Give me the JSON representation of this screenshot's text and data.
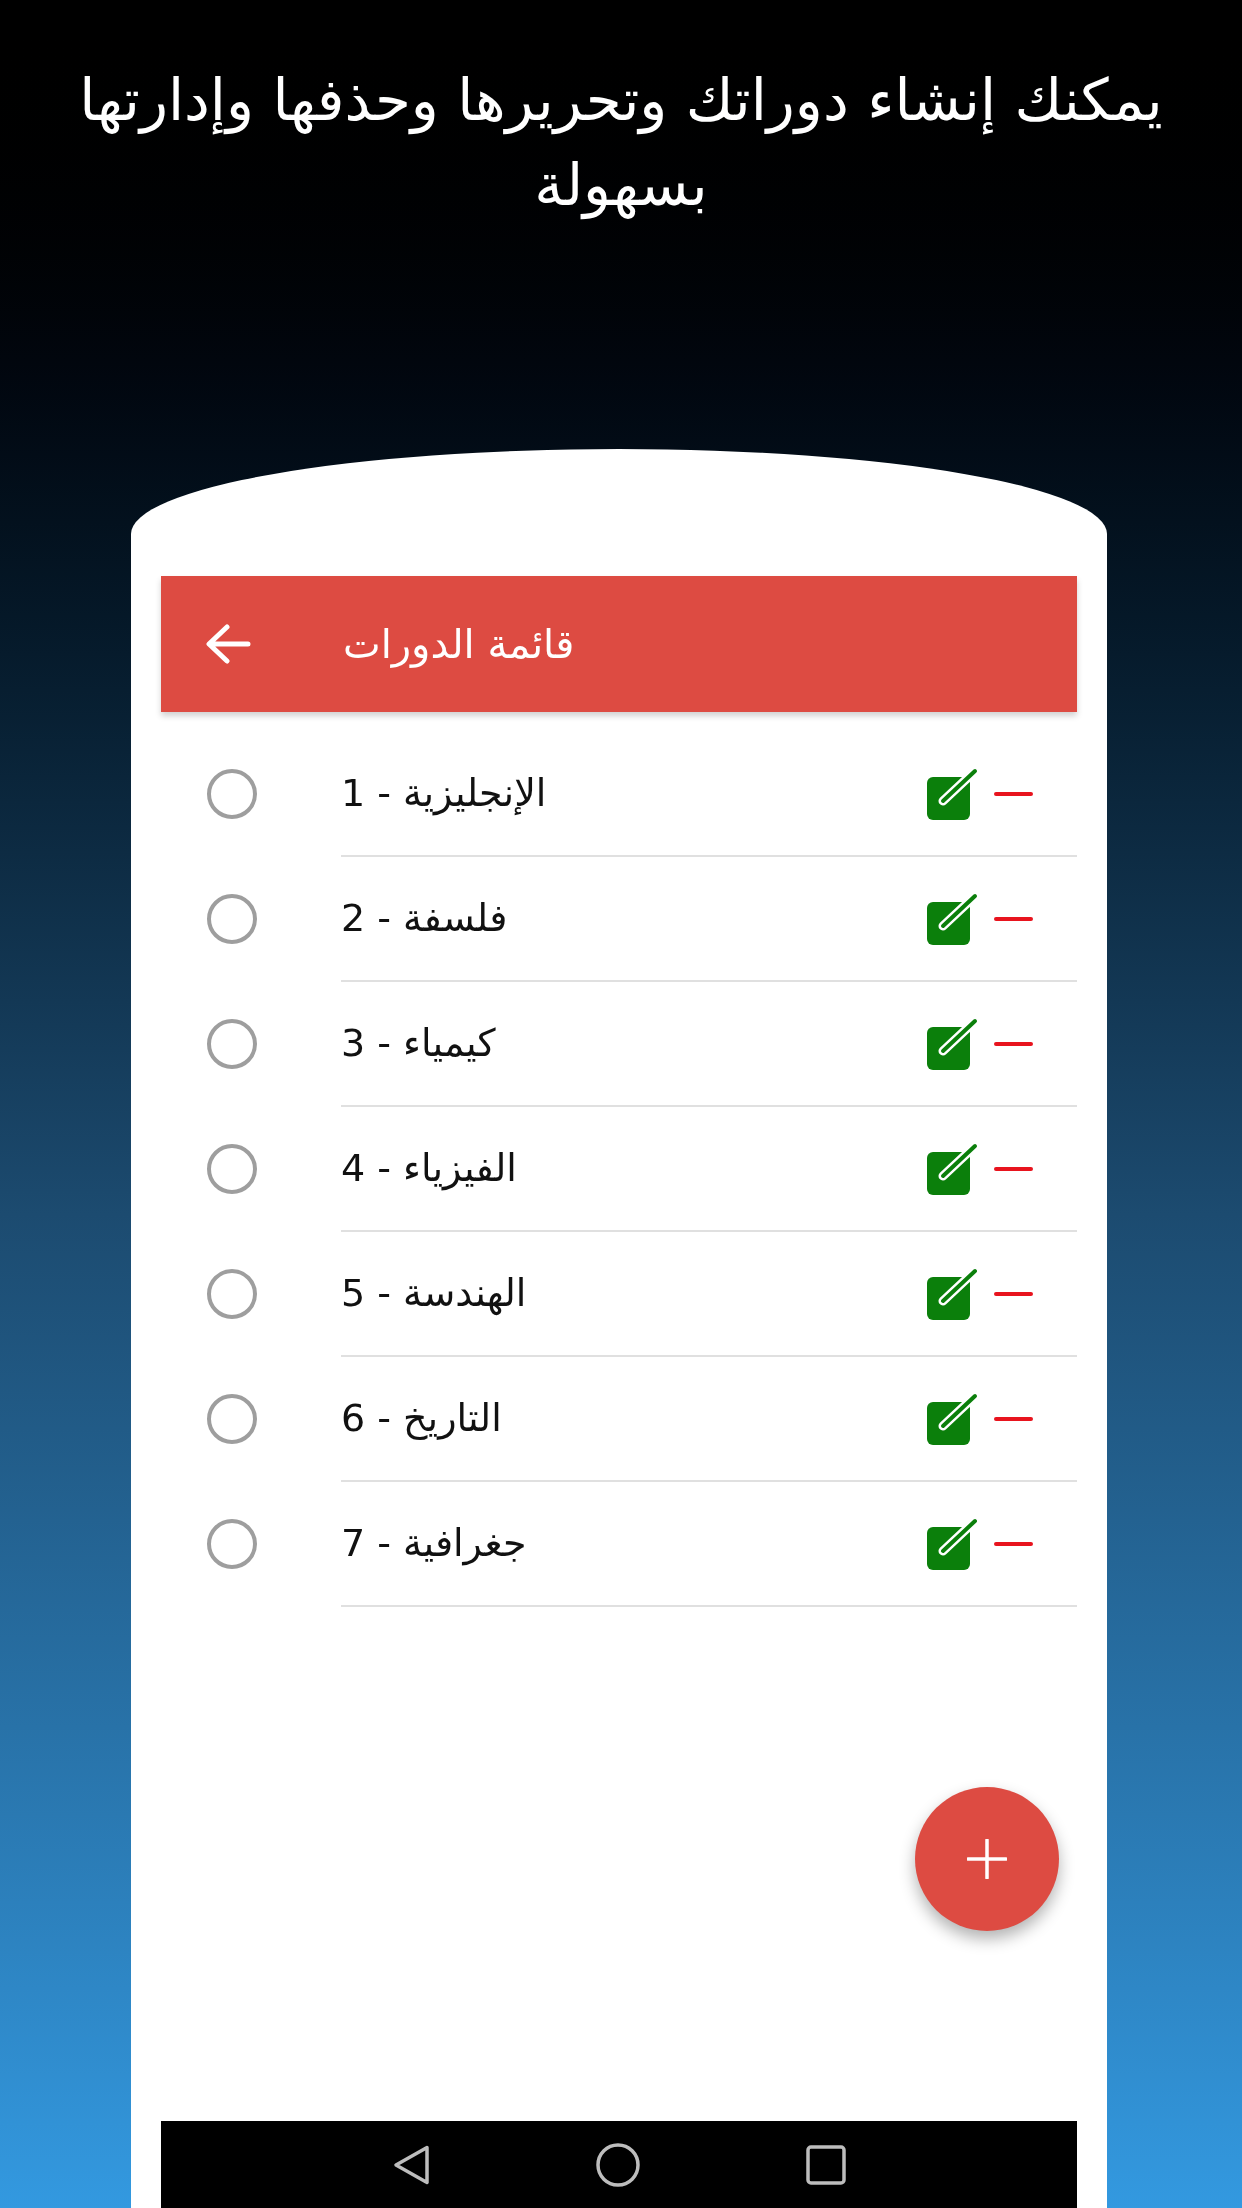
{
  "headline": "يمكنك إنشاء دوراتك وتحريرها وحذفها وإدارتها بسهولة",
  "app_bar": {
    "title": "قائمة الدورات"
  },
  "courses": [
    {
      "name": "الإنجليزية - 1",
      "selected": false
    },
    {
      "name": "فلسفة - 2",
      "selected": false
    },
    {
      "name": "كيمياء - 3",
      "selected": false
    },
    {
      "name": "الفيزياء - 4",
      "selected": false
    },
    {
      "name": "الهندسة - 5",
      "selected": false
    },
    {
      "name": "التاريخ - 6",
      "selected": false
    },
    {
      "name": "جغرافية - 7",
      "selected": false
    }
  ]
}
